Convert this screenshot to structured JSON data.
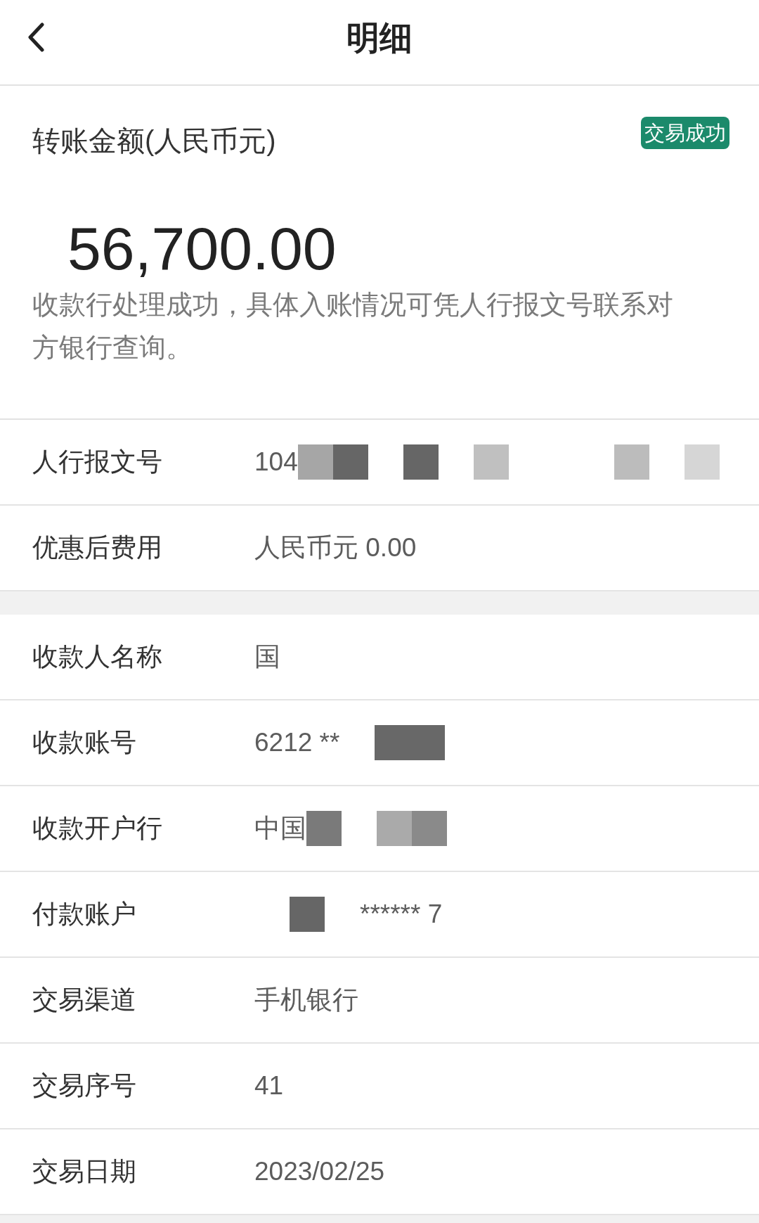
{
  "header": {
    "title": "明细"
  },
  "summary": {
    "label": "转账金额(人民币元)",
    "status": "交易成功",
    "amount": "56,700.00",
    "note": "收款行处理成功，具体入账情况可凭人行报文号联系对方银行查询。"
  },
  "groups": [
    {
      "rows": [
        {
          "label": "人行报文号",
          "value": [
            {
              "kind": "text",
              "text": "104"
            },
            {
              "kind": "tile",
              "color": "#a6a6a6"
            },
            {
              "kind": "tile",
              "color": "#666666"
            },
            {
              "kind": "blank"
            },
            {
              "kind": "tile",
              "color": "#666666"
            },
            {
              "kind": "blank"
            },
            {
              "kind": "tile",
              "color": "#c0c0c0"
            },
            {
              "kind": "blank"
            },
            {
              "kind": "blank"
            },
            {
              "kind": "blank"
            },
            {
              "kind": "tile",
              "color": "#bcbcbc"
            },
            {
              "kind": "blank"
            },
            {
              "kind": "tile",
              "color": "#d6d6d6"
            }
          ]
        },
        {
          "label": "优惠后费用",
          "value": [
            {
              "kind": "text",
              "text": "人民币元 0.00"
            }
          ]
        }
      ]
    },
    {
      "rows": [
        {
          "label": "收款人名称",
          "value": [
            {
              "kind": "text",
              "text": "国"
            }
          ]
        },
        {
          "label": "收款账号",
          "value": [
            {
              "kind": "text",
              "text": "6212 **"
            },
            {
              "kind": "blank"
            },
            {
              "kind": "tile",
              "color": "#686868"
            },
            {
              "kind": "tile",
              "color": "#686868"
            }
          ]
        },
        {
          "label": "收款开户行",
          "value": [
            {
              "kind": "text",
              "text": "中国"
            },
            {
              "kind": "tile",
              "color": "#7a7a7a"
            },
            {
              "kind": "blank"
            },
            {
              "kind": "tile",
              "color": "#aaaaaa"
            },
            {
              "kind": "tile",
              "color": "#8a8a8a"
            }
          ]
        },
        {
          "label": "付款账户",
          "value": [
            {
              "kind": "blank"
            },
            {
              "kind": "tile",
              "color": "#666666"
            },
            {
              "kind": "blank"
            },
            {
              "kind": "text",
              "text": "****** 7"
            }
          ]
        },
        {
          "label": "交易渠道",
          "value": [
            {
              "kind": "text",
              "text": "手机银行"
            }
          ]
        },
        {
          "label": "交易序号",
          "value": [
            {
              "kind": "text",
              "text": "41"
            }
          ]
        },
        {
          "label": "交易日期",
          "value": [
            {
              "kind": "text",
              "text": "2023/02/25"
            }
          ]
        }
      ]
    }
  ]
}
